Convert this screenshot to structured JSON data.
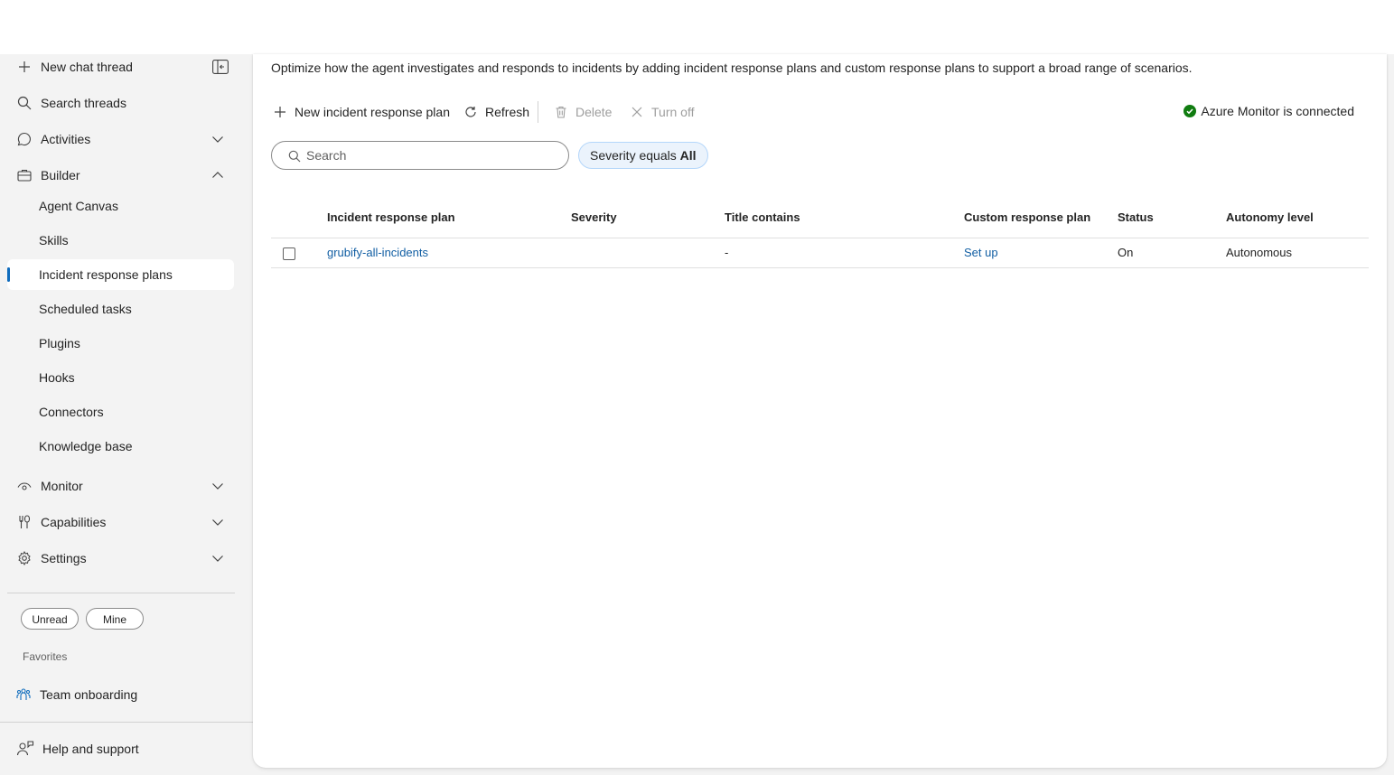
{
  "sidebar": {
    "new_chat": "New chat thread",
    "search_threads": "Search threads",
    "activities": "Activities",
    "builder": "Builder",
    "builder_items": [
      "Agent Canvas",
      "Skills",
      "Incident response plans",
      "Scheduled tasks",
      "Plugins",
      "Hooks",
      "Connectors",
      "Knowledge base"
    ],
    "active_item": "Incident response plans",
    "monitor": "Monitor",
    "capabilities": "Capabilities",
    "settings": "Settings",
    "filters": {
      "unread": "Unread",
      "mine": "Mine"
    },
    "favorites_heading": "Favorites",
    "favorite_item": "Team onboarding",
    "help": "Help and support"
  },
  "main": {
    "description": "Optimize how the agent investigates and responds to incidents by adding incident response plans and custom response plans to support a broad range of scenarios.",
    "toolbar": {
      "new_plan": "New incident response plan",
      "refresh": "Refresh",
      "delete": "Delete",
      "turn_off": "Turn off"
    },
    "connection_status": "Azure Monitor is connected",
    "search_placeholder": "Search",
    "filter": {
      "prefix": "Severity equals",
      "value": "All"
    },
    "table": {
      "columns": [
        "Incident response plan",
        "Severity",
        "Title contains",
        "Custom response plan",
        "Status",
        "Autonomy level"
      ],
      "rows": [
        {
          "plan": "grubify-all-incidents",
          "severity": "",
          "title_contains": "-",
          "custom_plan": "Set up",
          "status": "On",
          "autonomy": "Autonomous"
        }
      ]
    }
  },
  "colors": {
    "accent": "#0f6cbd",
    "link": "#115ea3",
    "success": "#107c10"
  }
}
